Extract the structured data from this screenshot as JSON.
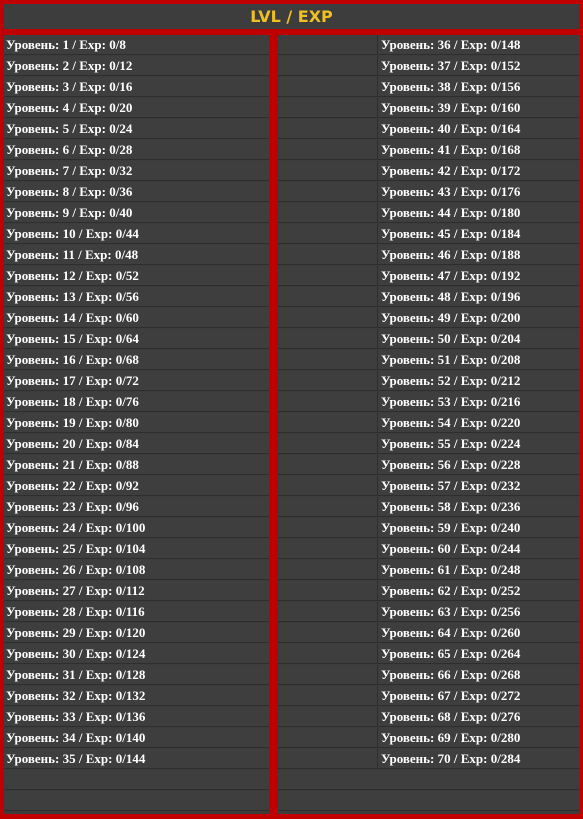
{
  "header": {
    "title": "LVL / EXP"
  },
  "left_rows": [
    "Уровень: 1 / Exp: 0/8",
    "Уровень: 2 / Exp: 0/12",
    "Уровень: 3 / Exp: 0/16",
    "Уровень: 4 / Exp: 0/20",
    "Уровень: 5 / Exp: 0/24",
    "Уровень: 6 / Exp: 0/28",
    "Уровень: 7 / Exp: 0/32",
    "Уровень: 8 / Exp: 0/36",
    "Уровень: 9 / Exp: 0/40",
    "Уровень: 10 / Exp: 0/44",
    "Уровень: 11 / Exp: 0/48",
    "Уровень: 12 / Exp: 0/52",
    "Уровень: 13 / Exp: 0/56",
    "Уровень: 14 / Exp: 0/60",
    "Уровень: 15 / Exp: 0/64",
    "Уровень: 16 / Exp: 0/68",
    "Уровень: 17 / Exp: 0/72",
    "Уровень: 18 / Exp: 0/76",
    "Уровень: 19 / Exp: 0/80",
    "Уровень: 20 / Exp: 0/84",
    "Уровень: 21 / Exp: 0/88",
    "Уровень: 22 / Exp: 0/92",
    "Уровень: 23 / Exp: 0/96",
    "Уровень: 24 / Exp: 0/100",
    "Уровень: 25 / Exp: 0/104",
    "Уровень: 26 / Exp: 0/108",
    "Уровень: 27 / Exp: 0/112",
    "Уровень: 28 / Exp: 0/116",
    "Уровень: 29 / Exp: 0/120",
    "Уровень: 30 / Exp: 0/124",
    "Уровень: 31 / Exp: 0/128",
    "Уровень: 32 / Exp: 0/132",
    "Уровень: 33 / Exp: 0/136",
    "Уровень: 34 / Exp: 0/140",
    "Уровень: 35 / Exp: 0/144"
  ],
  "right_rows": [
    "Уровень: 36 / Exp: 0/148",
    "Уровень: 37 / Exp: 0/152",
    "Уровень: 38 / Exp: 0/156",
    "Уровень: 39 / Exp: 0/160",
    "Уровень: 40 / Exp: 0/164",
    "Уровень: 41 / Exp: 0/168",
    "Уровень: 42 / Exp: 0/172",
    "Уровень: 43 / Exp: 0/176",
    "Уровень: 44 / Exp: 0/180",
    "Уровень: 45 / Exp: 0/184",
    "Уровень: 46 / Exp: 0/188",
    "Уровень: 47 / Exp: 0/192",
    "Уровень: 48 / Exp: 0/196",
    "Уровень: 49 / Exp: 0/200",
    "Уровень: 50 / Exp: 0/204",
    "Уровень: 51 / Exp: 0/208",
    "Уровень: 52 / Exp: 0/212",
    "Уровень: 53 / Exp: 0/216",
    "Уровень: 54 / Exp: 0/220",
    "Уровень: 55 / Exp: 0/224",
    "Уровень: 56 / Exp: 0/228",
    "Уровень: 57 / Exp: 0/232",
    "Уровень: 58 / Exp: 0/236",
    "Уровень: 59 / Exp: 0/240",
    "Уровень: 60 / Exp: 0/244",
    "Уровень: 61 / Exp: 0/248",
    "Уровень: 62 / Exp: 0/252",
    "Уровень: 63 / Exp: 0/256",
    "Уровень: 64 / Exp: 0/260",
    "Уровень: 65 / Exp: 0/264",
    "Уровень: 66 / Exp: 0/268",
    "Уровень: 67 / Exp: 0/272",
    "Уровень: 68 / Exp: 0/276",
    "Уровень: 69 / Exp: 0/280",
    "Уровень: 70 / Exp: 0/284"
  ],
  "colors": {
    "frame": "#c00000",
    "panel": "#3e3e3e",
    "title": "#f0c020",
    "text": "#ffffff"
  }
}
